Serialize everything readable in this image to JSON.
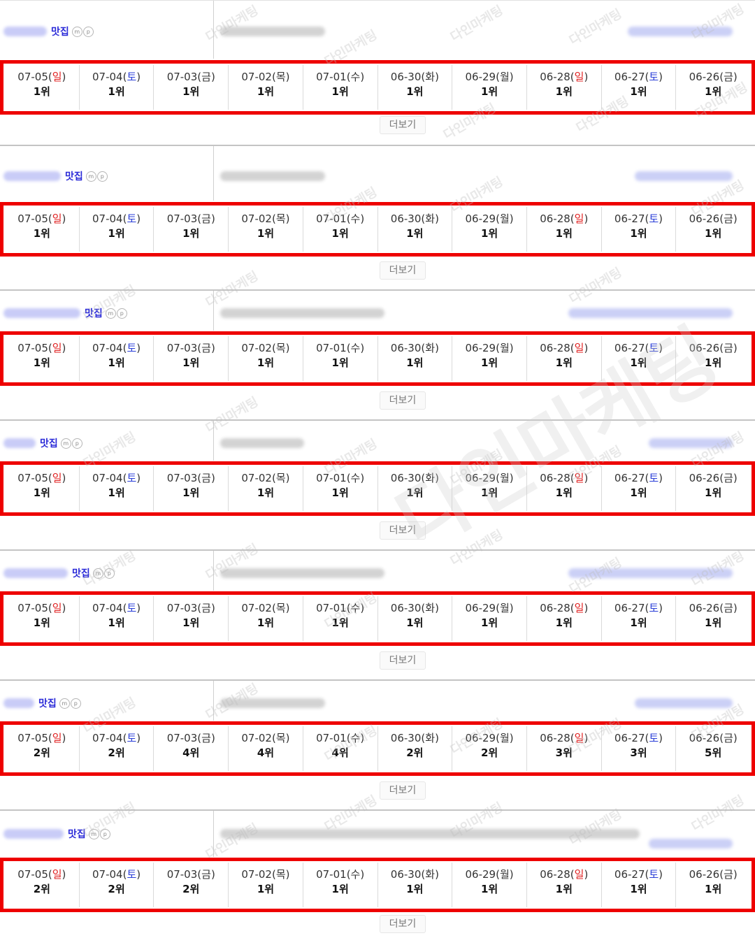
{
  "more_label": "더보기",
  "keyword_label": "맛집",
  "mp_badges": [
    "m",
    "p"
  ],
  "watermark_text": "다인마케팅",
  "colors": {
    "frame": "#ee0000",
    "sunday": "#e02020",
    "saturday": "#2b3fd8",
    "keyword": "#2b2bd8"
  },
  "dates": [
    {
      "date": "07-05",
      "dow": "일",
      "type": "sun"
    },
    {
      "date": "07-04",
      "dow": "토",
      "type": "sat"
    },
    {
      "date": "07-03",
      "dow": "금",
      "type": "wkd"
    },
    {
      "date": "07-02",
      "dow": "목",
      "type": "wkd"
    },
    {
      "date": "07-01",
      "dow": "수",
      "type": "wkd"
    },
    {
      "date": "06-30",
      "dow": "화",
      "type": "wkd"
    },
    {
      "date": "06-29",
      "dow": "월",
      "type": "wkd"
    },
    {
      "date": "06-28",
      "dow": "일",
      "type": "sun"
    },
    {
      "date": "06-27",
      "dow": "토",
      "type": "sat"
    },
    {
      "date": "06-26",
      "dow": "금",
      "type": "wkd"
    }
  ],
  "rows": [
    {
      "ranks": [
        "1위",
        "1위",
        "1위",
        "1위",
        "1위",
        "1위",
        "1위",
        "1위",
        "1위",
        "1위"
      ]
    },
    {
      "ranks": [
        "1위",
        "1위",
        "1위",
        "1위",
        "1위",
        "1위",
        "1위",
        "1위",
        "1위",
        "1위"
      ]
    },
    {
      "ranks": [
        "1위",
        "1위",
        "1위",
        "1위",
        "1위",
        "1위",
        "1위",
        "1위",
        "1위",
        "1위"
      ]
    },
    {
      "ranks": [
        "1위",
        "1위",
        "1위",
        "1위",
        "1위",
        "1위",
        "1위",
        "1위",
        "1위",
        "1위"
      ]
    },
    {
      "ranks": [
        "1위",
        "1위",
        "1위",
        "1위",
        "1위",
        "1위",
        "1위",
        "1위",
        "1위",
        "1위"
      ]
    },
    {
      "ranks": [
        "2위",
        "2위",
        "4위",
        "4위",
        "4위",
        "2위",
        "2위",
        "3위",
        "3위",
        "5위"
      ]
    },
    {
      "ranks": [
        "2위",
        "2위",
        "2위",
        "1위",
        "1위",
        "1위",
        "1위",
        "1위",
        "1위",
        "1위"
      ]
    }
  ]
}
